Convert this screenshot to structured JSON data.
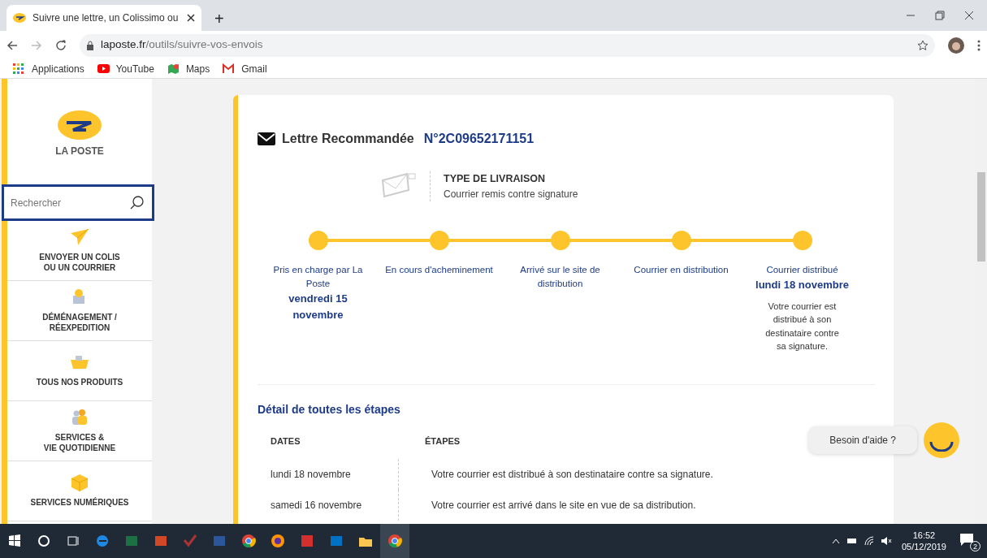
{
  "browser": {
    "tabs": [
      {
        "title": "Suivre une lettre, un Colissimo ou",
        "selected": true
      }
    ],
    "new_tab": "+",
    "address": {
      "domain": "laposte.fr",
      "path": "/outils/suivre-vos-envois"
    },
    "bookmarks": [
      {
        "label": "Applications",
        "kind": "apps"
      },
      {
        "label": "YouTube",
        "kind": "youtube"
      },
      {
        "label": "Maps",
        "kind": "maps"
      },
      {
        "label": "Gmail",
        "kind": "gmail"
      }
    ]
  },
  "sidebar": {
    "logo_text": "LA POSTE",
    "search": {
      "placeholder": "Rechercher"
    },
    "items": [
      {
        "label": "ENVOYER UN COLIS\nOU UN COURRIER",
        "kind": "plane"
      },
      {
        "label": "DÉMÉNAGEMENT /\nRÉEXPEDITION",
        "kind": "box"
      },
      {
        "label": "TOUS NOS PRODUITS",
        "kind": "basket"
      },
      {
        "label": "SERVICES &\nVIE QUOTIDIENNE",
        "kind": "people"
      },
      {
        "label": "SERVICES NUMÉRIQUES",
        "kind": "cube"
      }
    ]
  },
  "tracking": {
    "title": "Lettre Recommandée",
    "number": "N°2C09652171151",
    "delivery_type": {
      "heading": "TYPE DE LIVRAISON",
      "value": "Courrier remis contre signature"
    },
    "steps": [
      {
        "label": "Pris en charge par La Poste",
        "date": "vendredi 15 novembre",
        "reached": true
      },
      {
        "label": "En cours d'acheminement",
        "reached": true
      },
      {
        "label": "Arrivé sur le site de distribution",
        "reached": true
      },
      {
        "label": "Courrier en distribution",
        "reached": true
      },
      {
        "label": "Courrier distribué",
        "date": "lundi 18 novembre",
        "note": "Votre courrier est distribué à son destinataire contre sa signature.",
        "reached": true
      }
    ],
    "detail": {
      "title": "Détail de toutes les étapes",
      "columns": [
        "DATES",
        "ÉTAPES"
      ],
      "rows": [
        [
          "lundi 18 novembre",
          "Votre courrier est distribué à son destinataire contre sa signature."
        ],
        [
          "samedi 16 novembre",
          "Votre courrier est arrivé dans le site en vue de sa distribution."
        ]
      ]
    }
  },
  "help": {
    "label": "Besoin d'aide ?"
  },
  "taskbar": {
    "apps": [
      {
        "kind": "windows"
      },
      {
        "kind": "search"
      },
      {
        "kind": "taskview"
      },
      {
        "kind": "edge"
      },
      {
        "kind": "excel"
      },
      {
        "kind": "powerpoint"
      },
      {
        "kind": "app"
      },
      {
        "kind": "word"
      },
      {
        "kind": "chrome"
      },
      {
        "kind": "firefox"
      },
      {
        "kind": "acrobat"
      },
      {
        "kind": "outlook"
      },
      {
        "kind": "explorer"
      },
      {
        "kind": "chrome"
      }
    ],
    "time": "16:52",
    "date": "05/12/2019",
    "notifications": "2"
  }
}
